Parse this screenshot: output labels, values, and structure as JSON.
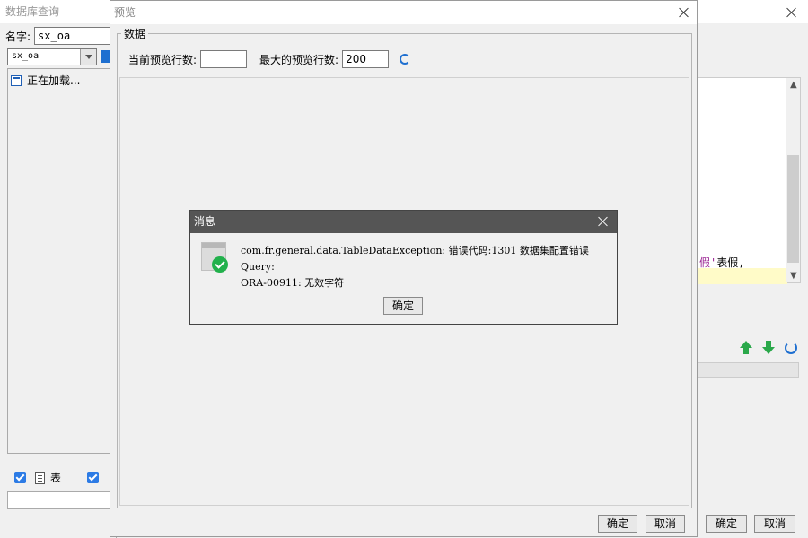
{
  "left_window": {
    "title": "数据库查询",
    "name_label": "名字:",
    "name_value": "sx_oa",
    "db_value": "sx_oa",
    "tree_item": "正在加载...",
    "table_check_label": "表"
  },
  "right_window": {
    "code_line_kw": "假'",
    "code_line_rest": "表假,",
    "ok_label": "确定",
    "cancel_label": "取消"
  },
  "preview": {
    "title": "预览",
    "group_label": "数据",
    "current_rows_label": "当前预览行数:",
    "current_rows_value": "",
    "max_rows_label": "最大的预览行数:",
    "max_rows_value": "200",
    "ok_label": "确定",
    "cancel_label": "取消"
  },
  "message": {
    "title": "消息",
    "line1": "com.fr.general.data.TableDataException: 错误代码:1301 数据集配置错误",
    "line2": "Query:",
    "line3": "ORA-00911: 无效字符",
    "ok_label": "确定"
  },
  "colors": {
    "accent_blue": "#1e6fd0",
    "success_green": "#22b14c",
    "dialog_header": "#555555"
  }
}
